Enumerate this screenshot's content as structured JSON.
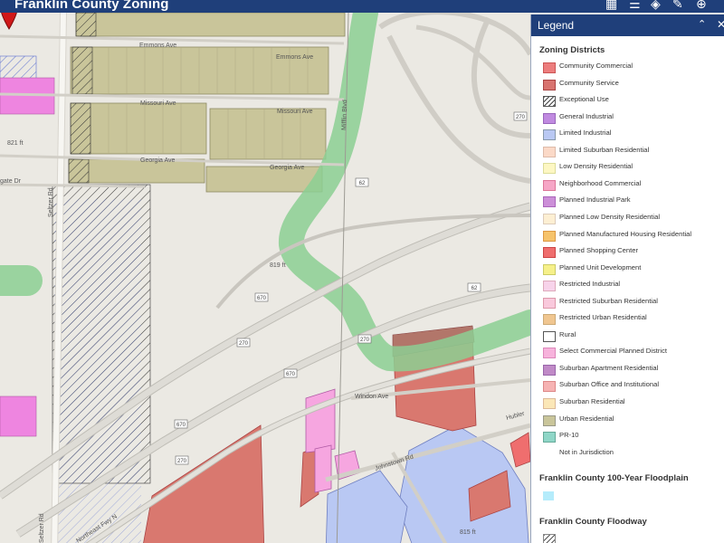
{
  "app": {
    "title": "Franklin County Zoning"
  },
  "toolbar": [
    {
      "name": "basemap-gallery-icon",
      "glyph": "▦"
    },
    {
      "name": "legend-list-icon",
      "glyph": "☰"
    },
    {
      "name": "layers-icon",
      "glyph": "◈"
    },
    {
      "name": "measure-icon",
      "glyph": "✎"
    },
    {
      "name": "globe-icon",
      "glyph": "⊕"
    }
  ],
  "map": {
    "streets": {
      "emmons_1": "Emmons Ave",
      "emmons_2": "Emmons Ave",
      "missouri_1": "Missouri Ave",
      "missouri_2": "Missouri Ave",
      "georgia_1": "Georgia Ave",
      "georgia_2": "Georgia Ave",
      "gate": "gate Dr",
      "seltzer_1": "Seltzer Rd",
      "seltzer_2": "Seltzer Rd",
      "mifflin": "Mifflin Blvd",
      "windon": "Windon Ave",
      "johnstown": "Johnstown Rd",
      "hubler": "Hubler",
      "northeast": "Northeast Fwy N"
    },
    "elevations": {
      "e1": "821 ft",
      "e2": "819 ft",
      "e3": "815 ft"
    },
    "shields": {
      "s62a": "62",
      "s62b": "62",
      "s270a": "270",
      "s270b": "270",
      "s270c": "270",
      "s270d": "270",
      "s670a": "670",
      "s670b": "670",
      "s670c": "670"
    }
  },
  "legend": {
    "title": "Legend",
    "collapse_glyph": "⌃",
    "close_glyph": "✕",
    "sections": {
      "zoning": "Zoning Districts",
      "floodplain": "Franklin County 100-Year Floodplain",
      "floodway": "Franklin County Floodway"
    },
    "items": [
      {
        "label": "Community Commercial",
        "color": "#ec7d7d",
        "border": "#c55"
      },
      {
        "label": "Community Service",
        "color": "#d8736f",
        "border": "#a44"
      },
      {
        "label": "Exceptional Use",
        "color": "hatch",
        "border": "#555"
      },
      {
        "label": "General Industrial",
        "color": "#c08ae0",
        "border": "#96b"
      },
      {
        "label": "Limited Industrial",
        "color": "#b9c8f3",
        "border": "#89a"
      },
      {
        "label": "Limited Suburban Residential",
        "color": "#fbd9c7",
        "border": "#dba"
      },
      {
        "label": "Low Density Residential",
        "color": "#fdf7c3",
        "border": "#dd9"
      },
      {
        "label": "Neighborhood Commercial",
        "color": "#f6a6c6",
        "border": "#d79"
      },
      {
        "label": "Planned Industrial Park",
        "color": "#cc8fd8",
        "border": "#a6b"
      },
      {
        "label": "Planned Low Density Residential",
        "color": "#fdefd3",
        "border": "#dcb"
      },
      {
        "label": "Planned Manufactured Housing Residential",
        "color": "#f6c36b",
        "border": "#d94"
      },
      {
        "label": "Planned Shopping Center",
        "color": "#ef6e6e",
        "border": "#c44"
      },
      {
        "label": "Planned Unit Development",
        "color": "#f6f08a",
        "border": "#cc6"
      },
      {
        "label": "Restricted Industrial",
        "color": "#f7d3ea",
        "border": "#dab"
      },
      {
        "label": "Restricted Suburban Residential",
        "color": "#f9c9dc",
        "border": "#d9a"
      },
      {
        "label": "Restricted Urban Residential",
        "color": "#f0c690",
        "border": "#ca7"
      },
      {
        "label": "Rural",
        "color": "#ffffff",
        "border": "#555"
      },
      {
        "label": "Select Commercial Planned District",
        "color": "#f7b3dc",
        "border": "#d8b"
      },
      {
        "label": "Suburban Apartment Residential",
        "color": "#c08ac7",
        "border": "#96a"
      },
      {
        "label": "Suburban Office and Institutional",
        "color": "#f6b3b3",
        "border": "#d88"
      },
      {
        "label": "Suburban Residential",
        "color": "#fbe7b7",
        "border": "#db9"
      },
      {
        "label": "Urban Residential",
        "color": "#c9c59a",
        "border": "#998"
      },
      {
        "label": "PR-10",
        "color": "#8fd6c7",
        "border": "#6a9"
      },
      {
        "label": "Not in Jurisdiction",
        "color": "none",
        "border": "none"
      }
    ],
    "floodplain_color": "#b5ecfb"
  }
}
